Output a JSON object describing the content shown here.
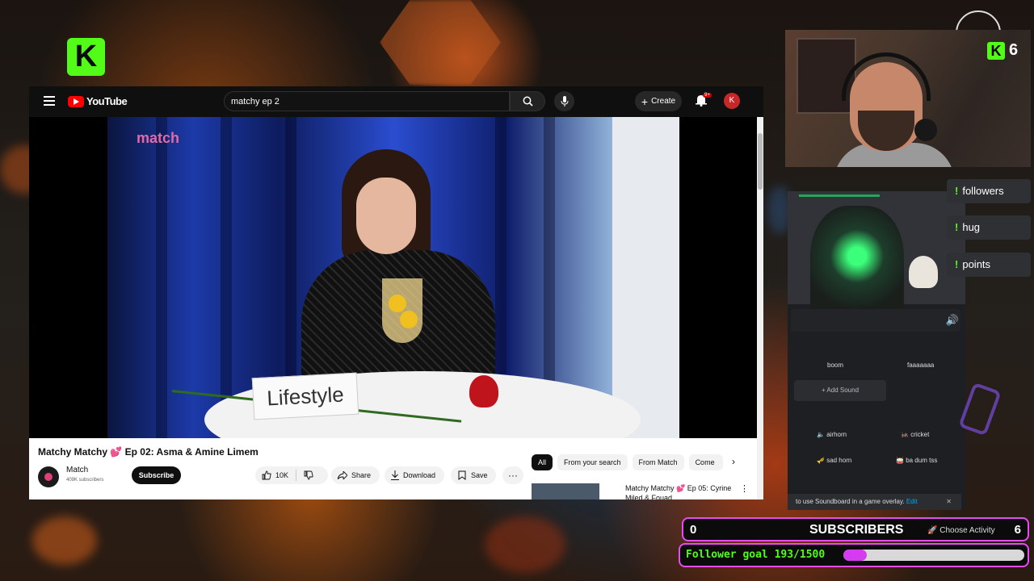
{
  "youtube": {
    "logo_text": "YouTube",
    "search_value": "matchy ep 2",
    "create_label": "Create",
    "notification_count": "9+",
    "avatar_initial": "K",
    "video_brand": "match",
    "nameplate": "Lifestyle",
    "video_title": "Matchy Matchy 💕 Ep 02: Asma & Amine Limem",
    "channel_name": "Match",
    "channel_subs": "409K subscribers",
    "subscribe_label": "Subscribe",
    "likes": "10K",
    "share_label": "Share",
    "download_label": "Download",
    "save_label": "Save",
    "chips": [
      "All",
      "From your search",
      "From Match",
      "Come"
    ],
    "related_title": "Matchy Matchy 💕 Ep 05: Cyrine Miled & Fouad"
  },
  "kick": {
    "logo": "K",
    "cam_count": "6"
  },
  "commands": [
    "followers",
    "hug",
    "points"
  ],
  "soundboard": {
    "sounds": [
      "boom",
      "faaaaaaa",
      "airhorn",
      "cricket",
      "sad horn",
      "ba dum tss"
    ],
    "add_sound": "Add Sound",
    "notice": "to use Soundboard in a game overlay.",
    "notice_link": "Edit",
    "choose_activity": "Choose Activity"
  },
  "overlay": {
    "subs_left": "0",
    "subs_label": "SUBSCRIBERS",
    "subs_right": "6",
    "goal_text": "Follower goal 193/1500",
    "goal_current": 193,
    "goal_target": 1500
  },
  "colors": {
    "kick_green": "#53fc18",
    "overlay_pink": "#e64cf0",
    "youtube_red": "#ff0000"
  }
}
